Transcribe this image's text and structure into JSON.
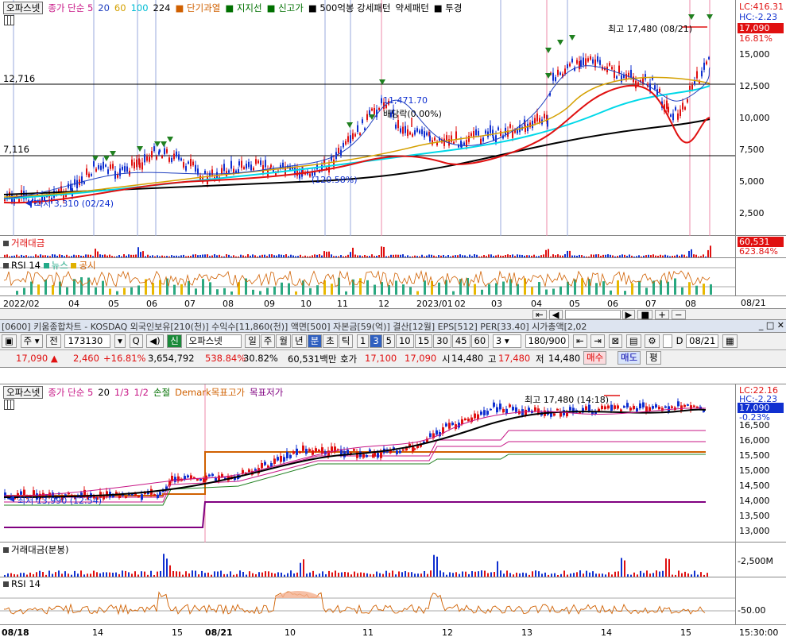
{
  "top_chart": {
    "legend": [
      {
        "text": "오파스넷",
        "color": "#000000",
        "boxed": true
      },
      {
        "text": "종가 단순 5",
        "color": "#c71585"
      },
      {
        "text": "20",
        "color": "#1f3fbf"
      },
      {
        "text": "60",
        "color": "#d4a000"
      },
      {
        "text": "100",
        "color": "#00bcd4"
      },
      {
        "text": "224",
        "color": "#000000"
      },
      {
        "text": "■ 단기과열",
        "color": "#d06000"
      },
      {
        "text": "■ 지지선",
        "color": "#007000"
      },
      {
        "text": "■ 신고가",
        "color": "#007000"
      },
      {
        "text": "■ 500억봉 강세패턴",
        "color": "#000000"
      },
      {
        "text": "약세패턴",
        "color": "#000000"
      },
      {
        "text": "■ 투경",
        "color": "#000000"
      }
    ],
    "hlines": [
      {
        "label": "12,716"
      },
      {
        "label": "7,116"
      }
    ],
    "annotations": {
      "high": "최고 17,480 (08/21)",
      "low": "최저 3,310 (02/24)",
      "mid_price": "11,471.70",
      "dividend": "배당락(0.00%)",
      "ratio": "(120.58%)"
    },
    "axis": {
      "lc": "LC:416.31",
      "hc": "HC:-2.23",
      "price_tag": "17,090",
      "pct_tag": "16.81%",
      "ticks": [
        "15,000",
        "12,500",
        "10,000",
        "7,500",
        "5,000",
        "2,500"
      ]
    },
    "volume": {
      "label": "거래대금",
      "axis_value": "60,531",
      "axis_pct": "623.84%"
    },
    "rsi": {
      "label": "RSI 14",
      "news": "뉴스",
      "notice": "공시"
    },
    "xaxis": [
      "2022/02",
      "04",
      "05",
      "06",
      "07",
      "08",
      "09",
      "10",
      "11",
      "12",
      "2023/01",
      "02",
      "03",
      "04",
      "05",
      "06",
      "07",
      "08"
    ],
    "xaxis_right": "08/21",
    "colors": {
      "up": "#e01010",
      "down": "#1030d0",
      "ma5": "#c71585",
      "ma20": "#1f3fbf",
      "ma60": "#d4a000",
      "ma100": "#00d8e8",
      "ma224": "#000000",
      "red_ma": "#e01010"
    }
  },
  "info_bar": {
    "text": "[0600] 키움종합차트 - KOSDAQ 외국인보유[210(천)] 수익수[11,860(천)] 액면[500] 자본금[59(억)] 결산[12월] EPS[512] PER[33.40] 시가총액[2,02"
  },
  "toolbar": {
    "chart_type_1": "주",
    "chart_type_2": "전",
    "code": "173130",
    "badge": "신",
    "stock_name": "오파스넷",
    "periods": [
      "일",
      "주",
      "월",
      "년",
      "분",
      "초",
      "틱"
    ],
    "active_period": "분",
    "intervals": [
      "1",
      "3",
      "5",
      "10",
      "15",
      "30",
      "45",
      "60"
    ],
    "active_interval": "3",
    "interval_select": "3",
    "count": "180",
    "count_total": "/900",
    "date_label": "D",
    "date_value": "08/21"
  },
  "quote_bar": {
    "price": "17,090",
    "change": "2,460",
    "change_pct": "+16.81%",
    "volume": "3,654,792",
    "vol_pct": "538.84%",
    "turnover": "30.82%",
    "amount": "60,531백만",
    "ask_label": "호가",
    "ask1": "17,100",
    "bid1": "17,090",
    "open_label": "시",
    "open": "14,480",
    "high_label": "고",
    "high": "17,480",
    "low_label": "저",
    "low": "14,480",
    "buy": "매수",
    "sell": "매도",
    "avg": "평"
  },
  "bottom_chart": {
    "legend": [
      {
        "text": "오파스넷",
        "color": "#000000",
        "boxed": true
      },
      {
        "text": "종가 단순 5",
        "color": "#c71585"
      },
      {
        "text": "20",
        "color": "#000000"
      },
      {
        "text": "1/3",
        "color": "#c71585"
      },
      {
        "text": "1/2",
        "color": "#c71585"
      },
      {
        "text": "손절",
        "color": "#007000"
      },
      {
        "text": "Demark목표고가",
        "color": "#d06000"
      },
      {
        "text": "목표저가",
        "color": "#800080"
      }
    ],
    "annotations": {
      "high": "최고 17,480 (14:18)",
      "low": "최저 13,990 (12:54)"
    },
    "axis": {
      "lc": "LC:22.16",
      "hc": "HC:-2.23",
      "price_tag": "17,090",
      "pct_tag": "-0.23%",
      "ticks": [
        "16,500",
        "16,000",
        "15,500",
        "15,000",
        "14,500",
        "14,000",
        "13,500",
        "13,000"
      ]
    },
    "volume": {
      "label": "거래대금(분봉)",
      "axis_value": "2,500M"
    },
    "rsi": {
      "label": "RSI 14",
      "axis_value": "50.00"
    },
    "xaxis": [
      "08/18",
      "14",
      "15",
      "08/21",
      "10",
      "11",
      "12",
      "13",
      "14",
      "15"
    ],
    "xaxis_right": "15:30:00"
  }
}
